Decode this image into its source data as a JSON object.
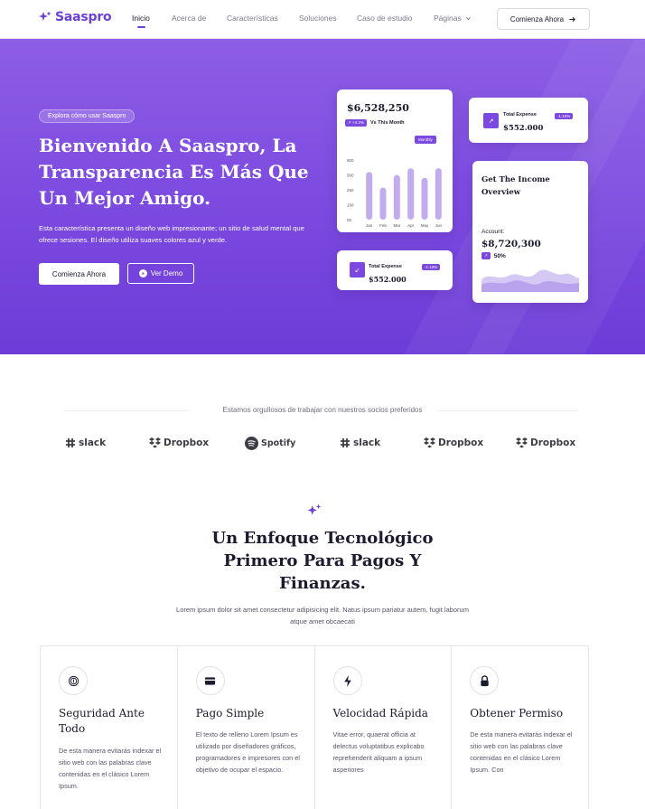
{
  "brand": {
    "name": "Saaspro",
    "accent": "#6c3fd6"
  },
  "nav": {
    "links": [
      {
        "label": "Inicio",
        "active": true
      },
      {
        "label": "Acerca de",
        "active": false
      },
      {
        "label": "Características",
        "active": false
      },
      {
        "label": "Soluciones",
        "active": false
      },
      {
        "label": "Caso de estudio",
        "active": false
      },
      {
        "label": "Páginas",
        "active": false
      }
    ],
    "cta": "Comienza Ahora"
  },
  "hero": {
    "badge": "Explora cómo usar Saaspro",
    "title": "Bienvenido A Saaspro, La Transparencia Es Más Que Un Mejor Amigo.",
    "subtitle": "Esta característica presenta un diseño web impresionante; un sitio de salud mental que ofrece sesiones. El diseño utiliza suaves colores azul y verde.",
    "primary_button": "Comienza Ahora",
    "demo_button": "Ver Demo"
  },
  "cards": {
    "chart_card": {
      "amount": "$6,528,250",
      "change": "+4.2%",
      "caption": "Vs This Month",
      "period": "Monthly",
      "y_ticks": [
        "800",
        "500",
        "250",
        "150",
        "00"
      ]
    },
    "expense_card_1": {
      "label": "Total Expense",
      "badge": "-1.10%",
      "amount": "$552.000"
    },
    "expense_card_2": {
      "label": "Total Expense",
      "badge": "-1.10%",
      "amount": "$552.000"
    },
    "income_card": {
      "title": "Get The Income Overview",
      "account_label": "Account:",
      "amount": "$8,720,300",
      "percent": "50%"
    }
  },
  "chart_data": {
    "type": "bar",
    "categories": [
      "Jan",
      "Feb",
      "Mar",
      "Apr",
      "May",
      "Jun"
    ],
    "values": [
      640,
      430,
      600,
      690,
      560,
      690
    ],
    "ylim": [
      0,
      800
    ]
  },
  "partners": {
    "title": "Estamos orgullosos de trabajar con nuestros socios preferidos",
    "logos": [
      "slack",
      "Dropbox",
      "Spotify",
      "slack",
      "Dropbox",
      "Dropbox"
    ]
  },
  "features": {
    "title": "Un Enfoque Tecnológico Primero Para Pagos Y Finanzas.",
    "subtitle": "Lorem ipsum dolor sit amet consectetur adipisicing elit. Natus ipsum pariatur autem, fugit laborum atque amet obcaecati",
    "items": [
      {
        "title": "Seguridad Ante Todo",
        "text": "De esta manera evitarás indexar el sitio web con las palabras clave contenidas en el clásico Lorem Ipsum.",
        "icon": "fingerprint-icon"
      },
      {
        "title": "Pago Simple",
        "text": "El texto de relleno Lorem Ipsum es utilizado por diseñadores gráficos, programadores e impresores con el objetivo de ocupar el espacio.",
        "icon": "credit-card-icon"
      },
      {
        "title": "Velocidad Rápida",
        "text": "Vitae error, quaerat officia at delectus voluptatibus explicabo reprehenderit aliquam a ipsum asperiores",
        "icon": "lightning-icon"
      },
      {
        "title": "Obtener Permiso",
        "text": "De esta manera evitarás indexar el sitio web con las palabras clave contenidas en el clásico Lorem Ipsum. Con",
        "icon": "lock-icon"
      }
    ]
  }
}
